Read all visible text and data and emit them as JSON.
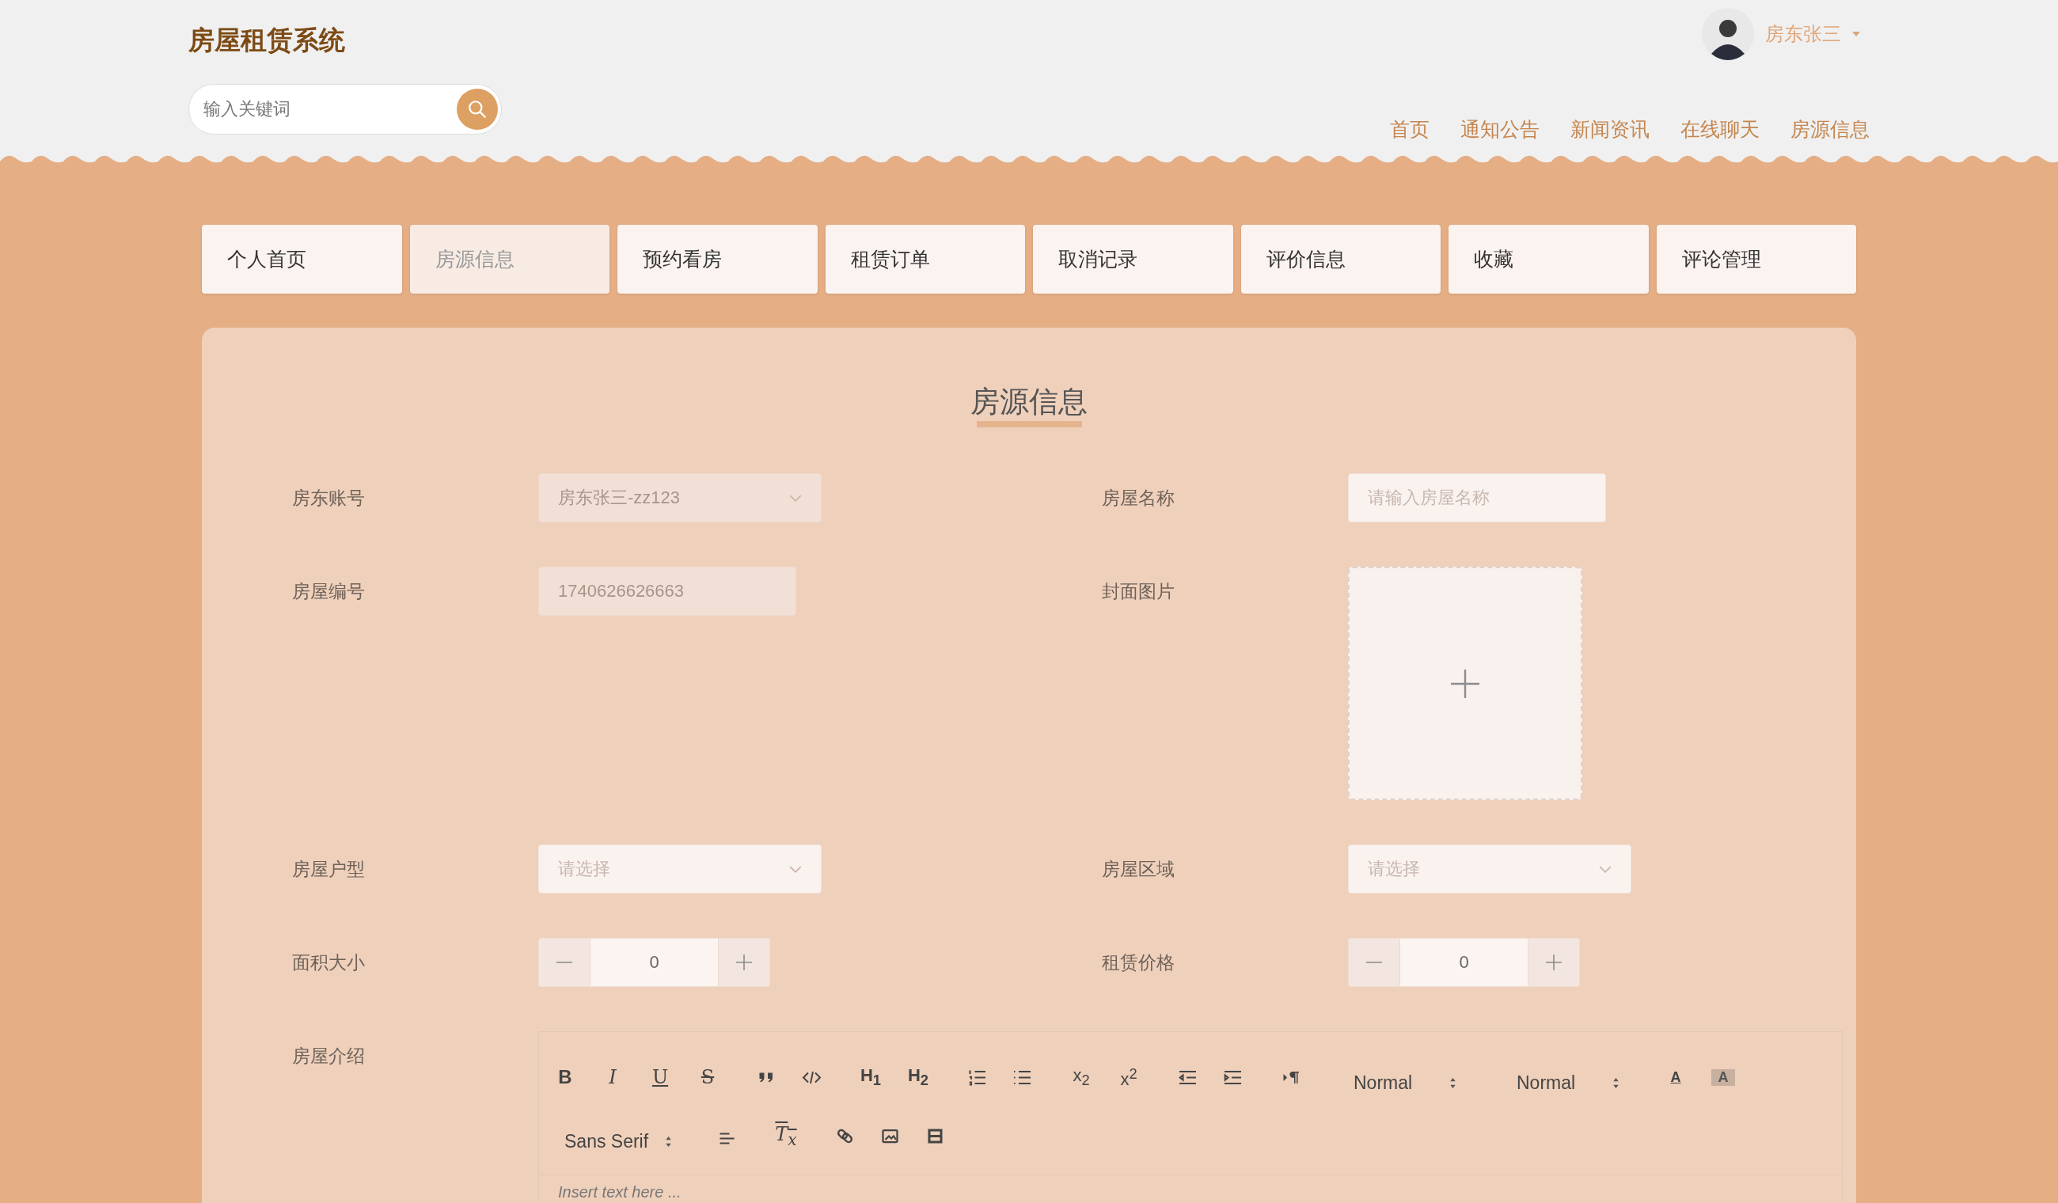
{
  "header": {
    "title": "房屋租赁系统",
    "search": {
      "placeholder": "输入关键词"
    },
    "user": {
      "name": "房东张三"
    },
    "nav": [
      {
        "label": "首页"
      },
      {
        "label": "通知公告"
      },
      {
        "label": "新闻资讯"
      },
      {
        "label": "在线聊天"
      },
      {
        "label": "房源信息"
      }
    ]
  },
  "tabs": [
    {
      "label": "个人首页",
      "selected": false
    },
    {
      "label": "房源信息",
      "selected": true
    },
    {
      "label": "预约看房",
      "selected": false
    },
    {
      "label": "租赁订单",
      "selected": false
    },
    {
      "label": "取消记录",
      "selected": false
    },
    {
      "label": "评价信息",
      "selected": false
    },
    {
      "label": "收藏",
      "selected": false
    },
    {
      "label": "评论管理",
      "selected": false
    }
  ],
  "form": {
    "title": "房源信息",
    "fields": [
      {
        "kind": "select",
        "label": "房东账号",
        "value": "房东张三-zz123",
        "disabled": true
      },
      {
        "kind": "input",
        "label": "房屋名称",
        "placeholder": "请输入房屋名称",
        "disabled": false
      },
      {
        "kind": "input",
        "label": "房屋编号",
        "value": "1740626626663",
        "disabled": true
      },
      {
        "kind": "upload",
        "label": "封面图片"
      },
      {
        "kind": "select",
        "label": "房屋户型",
        "placeholder": "请选择",
        "disabled": false
      },
      {
        "kind": "select",
        "label": "房屋区域",
        "placeholder": "请选择",
        "disabled": false
      },
      {
        "kind": "number",
        "label": "面积大小",
        "value": "0"
      },
      {
        "kind": "number",
        "label": "租赁价格",
        "value": "0"
      },
      {
        "kind": "editor",
        "label": "房屋介绍",
        "placeholder": "Insert text here ...",
        "toolbar": [
          [
            [
              {
                "kind": "bold",
                "label": "B"
              },
              {
                "kind": "italic",
                "label": "I"
              },
              {
                "kind": "underline",
                "label": "U"
              },
              {
                "kind": "strike",
                "label": "S"
              }
            ],
            [
              {
                "kind": "quote"
              },
              {
                "kind": "code"
              }
            ],
            [
              {
                "kind": "header",
                "label": "H$_{1}$"
              },
              {
                "kind": "header",
                "label": "H$_{2}$"
              }
            ],
            [
              {
                "kind": "ordered-list"
              },
              {
                "kind": "bullet-list"
              }
            ],
            [
              {
                "kind": "script",
                "label": "x$_{2}$"
              },
              {
                "kind": "script",
                "label": "x$^{2}$"
              }
            ],
            [
              {
                "kind": "outdent"
              },
              {
                "kind": "indent"
              }
            ],
            [
              {
                "kind": "direction"
              }
            ],
            [
              {
                "kind": "picker",
                "label": "Normal"
              }
            ],
            [
              {
                "kind": "picker",
                "label": "Normal"
              }
            ],
            [
              {
                "kind": "color",
                "label": "A"
              },
              {
                "kind": "background",
                "label": "A"
              }
            ]
          ],
          [
            [
              {
                "kind": "picker",
                "label": "Sans Serif"
              }
            ],
            [
              {
                "kind": "align"
              }
            ],
            [
              {
                "kind": "clean",
                "label": "T$_{x}$"
              }
            ],
            [
              {
                "kind": "link"
              },
              {
                "kind": "image"
              },
              {
                "kind": "video"
              }
            ]
          ]
        ]
      }
    ]
  }
}
